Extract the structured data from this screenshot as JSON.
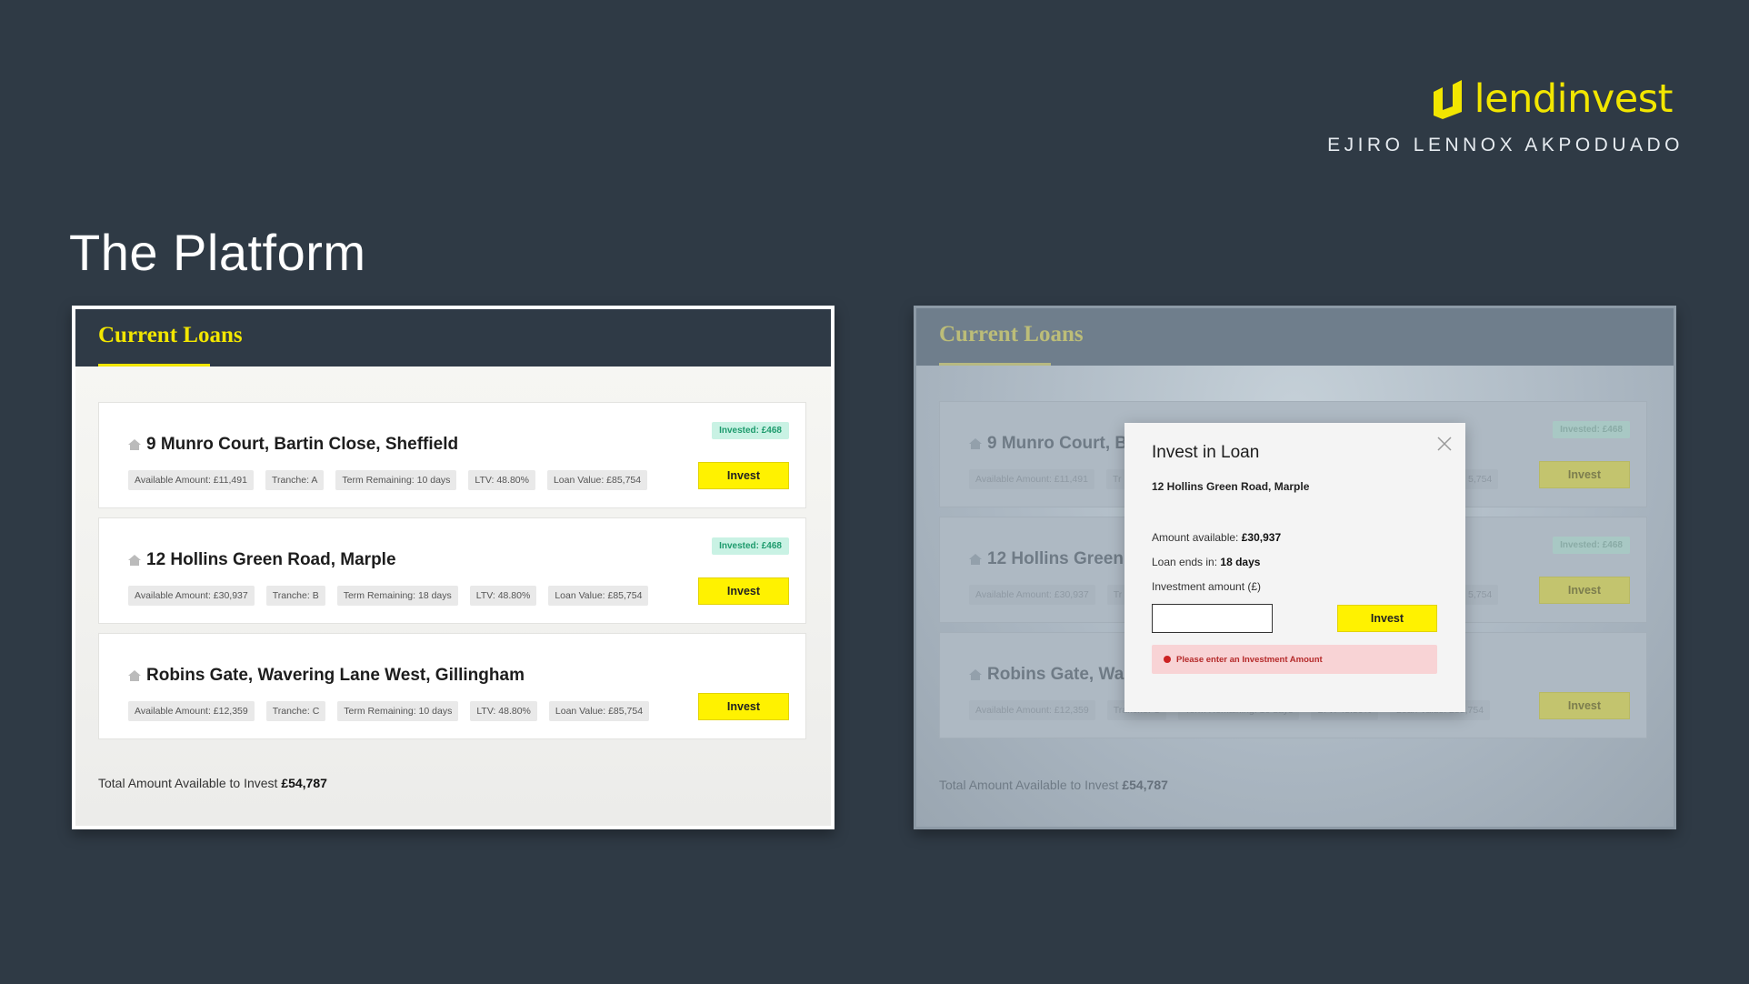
{
  "brand": {
    "name": "lendinvest",
    "author": "EJIRO LENNOX AKPODUADO"
  },
  "page_title": "The Platform",
  "current_loans": {
    "title": "Current Loans",
    "loans": [
      {
        "address": "9 Munro Court, Bartin Close, Sheffield",
        "invested": "Invested: £468",
        "tags": [
          "Available Amount: £11,491",
          "Tranche: A",
          "Term Remaining: 10 days",
          "LTV: 48.80%",
          "Loan Value: £85,754"
        ],
        "button": "Invest"
      },
      {
        "address": "12 Hollins Green Road, Marple",
        "invested": "Invested: £468",
        "tags": [
          "Available Amount: £30,937",
          "Tranche: B",
          "Term Remaining: 18 days",
          "LTV: 48.80%",
          "Loan Value: £85,754"
        ],
        "button": "Invest"
      },
      {
        "address": "Robins Gate, Wavering Lane West, Gillingham",
        "invested": "",
        "tags": [
          "Available Amount: £12,359",
          "Tranche: C",
          "Term Remaining: 10 days",
          "LTV: 48.80%",
          "Loan Value: £85,754"
        ],
        "button": "Invest"
      }
    ],
    "total_label": "Total Amount Available to Invest",
    "total_value": "£54,787"
  },
  "right_panel": {
    "loans": [
      {
        "address": "9 Munro Court, B",
        "invested": "Invested: £468",
        "tags": [
          "Available Amount: £11,491",
          "Tr"
        ],
        "tail": "5,754",
        "button": "Invest"
      },
      {
        "address": "12 Hollins Green",
        "invested": "Invested: £468",
        "tags": [
          "Available Amount: £30,937",
          "Tr"
        ],
        "tail": "5,754",
        "button": "Invest"
      },
      {
        "address": "Robins Gate, Wa",
        "invested": "",
        "tags": [
          "Available Amount: £12,359",
          "Tranche: C",
          "Term Remaining: 10 days",
          "LTV: 48.80%",
          "Loan Value: £85,754"
        ],
        "tail": "",
        "button": "Invest"
      }
    ]
  },
  "modal": {
    "title": "Invest in Loan",
    "subtitle": "12 Hollins Green Road, Marple",
    "amount_available_label": "Amount available:",
    "amount_available_value": "£30,937",
    "loan_ends_label": "Loan ends in:",
    "loan_ends_value": "18 days",
    "investment_amount_label": "Investment amount (£)",
    "input_value": "",
    "button": "Invest",
    "error": "Please enter an Investment Amount"
  },
  "colors": {
    "background": "#2f3a45",
    "accent": "#f2e600",
    "invest_button": "#fff200",
    "invested_badge": "#c9f2e4",
    "error_bg": "#f8d3d5"
  },
  "icons": {
    "brand": "lendinvest-logo-icon",
    "loan": "home-icon",
    "close": "close-icon",
    "error": "error-icon"
  }
}
